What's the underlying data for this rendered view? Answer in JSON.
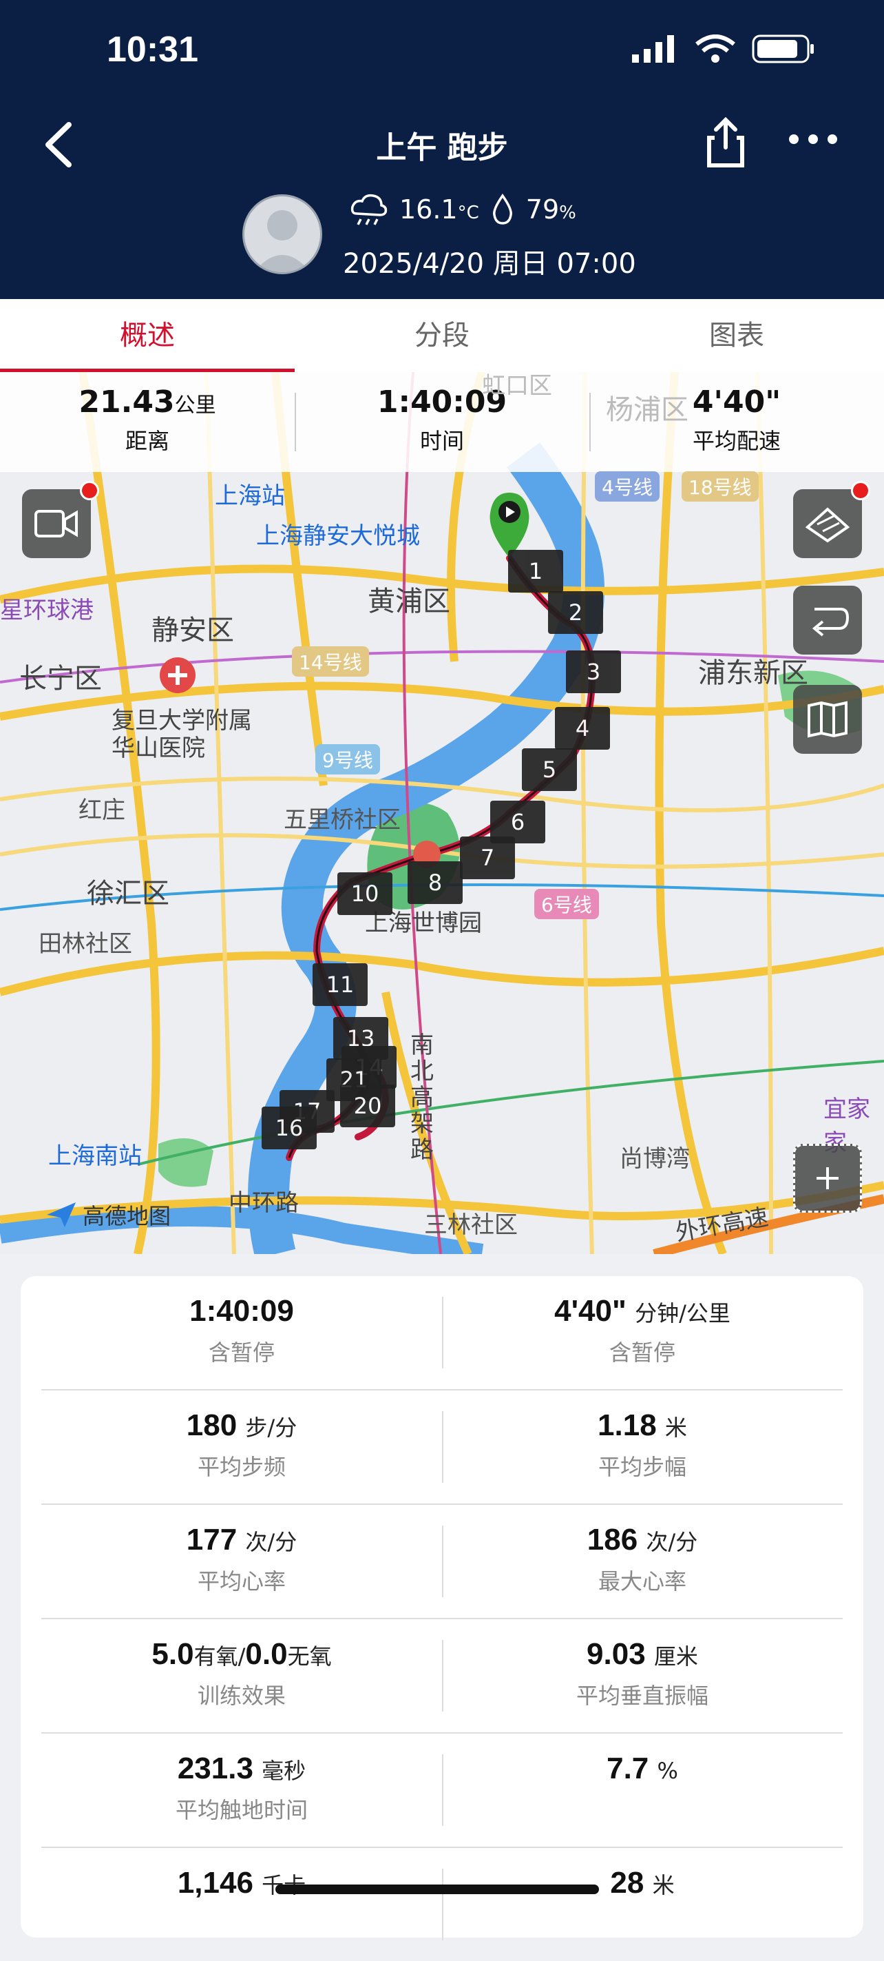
{
  "status_bar": {
    "time": "10:31"
  },
  "header": {
    "title": "上午 跑步",
    "temperature": "16.1",
    "temp_unit": "°C",
    "humidity": "79",
    "humidity_unit": "%",
    "datetime": "2025/4/20 周日 07:00"
  },
  "tabs": [
    {
      "label": "概述",
      "active": true
    },
    {
      "label": "分段",
      "active": false
    },
    {
      "label": "图表",
      "active": false
    }
  ],
  "summary": {
    "distance": "21.43",
    "distance_unit": "公里",
    "distance_label": "距离",
    "time": "1:40:09",
    "time_label": "时间",
    "pace": "4'40\"",
    "pace_label": "平均配速"
  },
  "map": {
    "labels": {
      "shanghai_station": "上海站",
      "jingan_mall": "上海静安大悦城",
      "huangpu": "黄浦区",
      "jingan": "静安区",
      "changning": "长宁区",
      "huashan": "复旦大学附属华山医院",
      "hongzhuang": "红庄",
      "xuhui": "徐汇区",
      "tianlin": "田林社区",
      "pudong": "浦东新区",
      "wuliqiao": "五里桥社区",
      "expo": "上海世博园",
      "south_station": "上海南站",
      "zhonghuan": "中环路",
      "sanlin": "三林社区",
      "nanbei": "南北高架路",
      "shangbowan": "尚博湾",
      "waihuan": "外环高速",
      "yijia": "宜家家",
      "yangpu": "杨浦区",
      "hongkou": "虹口区",
      "gaode": "高德地图",
      "stadium": "星环球港"
    },
    "metro_lines": {
      "line4": "4号线",
      "line18": "18号线",
      "line14": "14号线",
      "line9": "9号线",
      "line6": "6号线"
    },
    "km_markers": [
      "1",
      "2",
      "3",
      "4",
      "5",
      "6",
      "7",
      "8",
      "10",
      "11",
      "13",
      "14",
      "21",
      "17",
      "16",
      "20"
    ]
  },
  "stats": [
    {
      "left": {
        "value": "1:40:09",
        "unit": "",
        "label": "含暂停"
      },
      "right": {
        "value": "4'40\"",
        "unit": "分钟/公里",
        "label": "含暂停"
      }
    },
    {
      "left": {
        "value": "180",
        "unit": "步/分",
        "label": "平均步频"
      },
      "right": {
        "value": "1.18",
        "unit": "米",
        "label": "平均步幅"
      }
    },
    {
      "left": {
        "value": "177",
        "unit": "次/分",
        "label": "平均心率"
      },
      "right": {
        "value": "186",
        "unit": "次/分",
        "label": "最大心率"
      }
    },
    {
      "left": {
        "value": "5.0",
        "unit": "有氧/",
        "value2": "0.0",
        "unit2": "无氧",
        "label": "训练效果"
      },
      "right": {
        "value": "9.03",
        "unit": "厘米",
        "label": "平均垂直振幅"
      }
    },
    {
      "left": {
        "value": "231.3",
        "unit": "毫秒",
        "label": "平均触地时间"
      },
      "right": {
        "value": "7.7",
        "unit": "%",
        "label": ""
      }
    },
    {
      "left": {
        "value": "1,146",
        "unit": "千卡",
        "label": ""
      },
      "right": {
        "value": "28",
        "unit": "米",
        "label": ""
      }
    }
  ]
}
